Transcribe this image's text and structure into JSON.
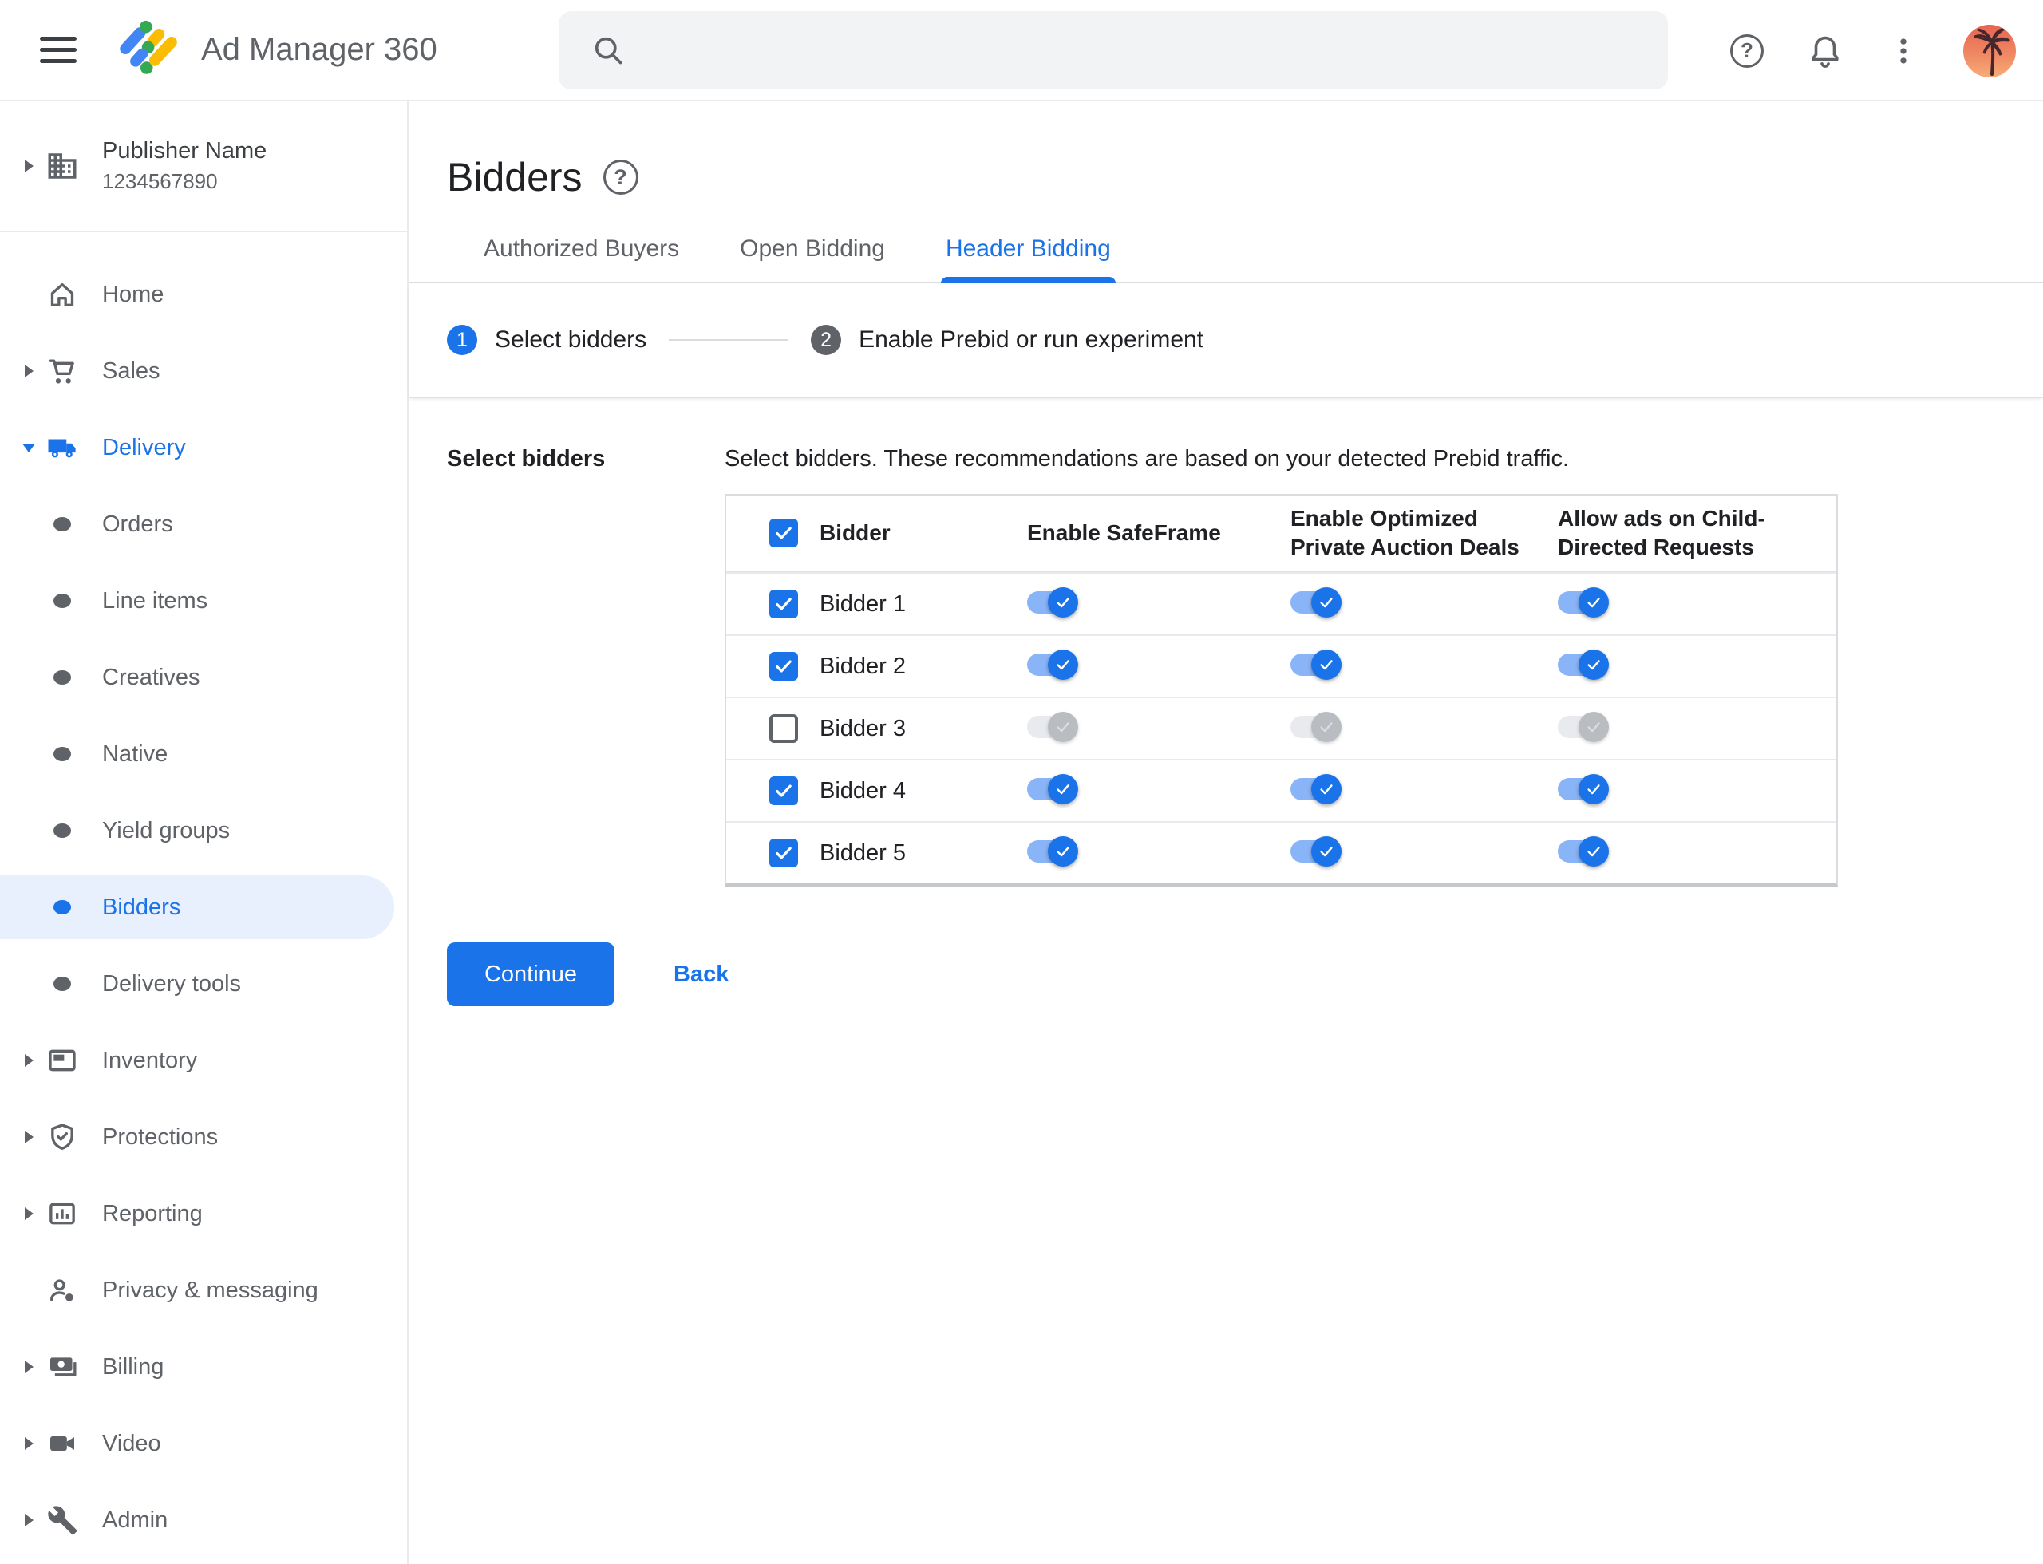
{
  "topbar": {
    "product_name": "Ad Manager 360",
    "search_placeholder": "",
    "help_glyph": "?"
  },
  "sidebar": {
    "publisher": {
      "name": "Publisher Name",
      "id": "1234567890"
    },
    "items": [
      {
        "label": "Home"
      },
      {
        "label": "Sales"
      },
      {
        "label": "Delivery"
      },
      {
        "label": "Orders"
      },
      {
        "label": "Line items"
      },
      {
        "label": "Creatives"
      },
      {
        "label": "Native"
      },
      {
        "label": "Yield groups"
      },
      {
        "label": "Bidders"
      },
      {
        "label": "Delivery tools"
      },
      {
        "label": "Inventory"
      },
      {
        "label": "Protections"
      },
      {
        "label": "Reporting"
      },
      {
        "label": "Privacy & messaging"
      },
      {
        "label": "Billing"
      },
      {
        "label": "Video"
      },
      {
        "label": "Admin"
      }
    ]
  },
  "page": {
    "title": "Bidders",
    "help_glyph": "?",
    "tabs": [
      {
        "label": "Authorized Buyers",
        "active": false
      },
      {
        "label": "Open Bidding",
        "active": false
      },
      {
        "label": "Header Bidding",
        "active": true
      }
    ],
    "stepper": [
      {
        "number": "1",
        "label": "Select bidders",
        "state": "active"
      },
      {
        "number": "2",
        "label": "Enable Prebid or run experiment",
        "state": "upcoming"
      }
    ],
    "section_label": "Select bidders",
    "description": "Select bidders. These recommendations are based on your detected Prebid traffic.",
    "table": {
      "select_all_state": "checked",
      "headers": {
        "bidder": "Bidder",
        "safeframe": "Enable SafeFrame",
        "optimized": "Enable Optimized Private Auction Deals",
        "child_directed": "Allow ads on Child-Directed Requests"
      },
      "rows": [
        {
          "name": "Bidder 1",
          "checkbox": "checked",
          "safeframe": "on",
          "optimized": "on",
          "child_directed": "on"
        },
        {
          "name": "Bidder 2",
          "checkbox": "checked",
          "safeframe": "on",
          "optimized": "on",
          "child_directed": "on"
        },
        {
          "name": "Bidder 3",
          "checkbox": "unchecked",
          "safeframe": "disabled",
          "optimized": "disabled",
          "child_directed": "disabled"
        },
        {
          "name": "Bidder 4",
          "checkbox": "checked",
          "safeframe": "on",
          "optimized": "on",
          "child_directed": "on"
        },
        {
          "name": "Bidder 5",
          "checkbox": "checked",
          "safeframe": "on",
          "optimized": "on",
          "child_directed": "on"
        }
      ]
    },
    "actions": {
      "continue": "Continue",
      "back": "Back"
    }
  },
  "colors": {
    "accent": "#1A73E8",
    "toggle_track_on": "#8AB4F8",
    "toggle_track_disabled": "#E9EAED",
    "toggle_thumb_disabled": "#B9BDC1",
    "selected_nav_bg": "#E8F0FE",
    "border": "#DADCE0",
    "text_primary": "#202124",
    "text_secondary": "#5F6368"
  }
}
